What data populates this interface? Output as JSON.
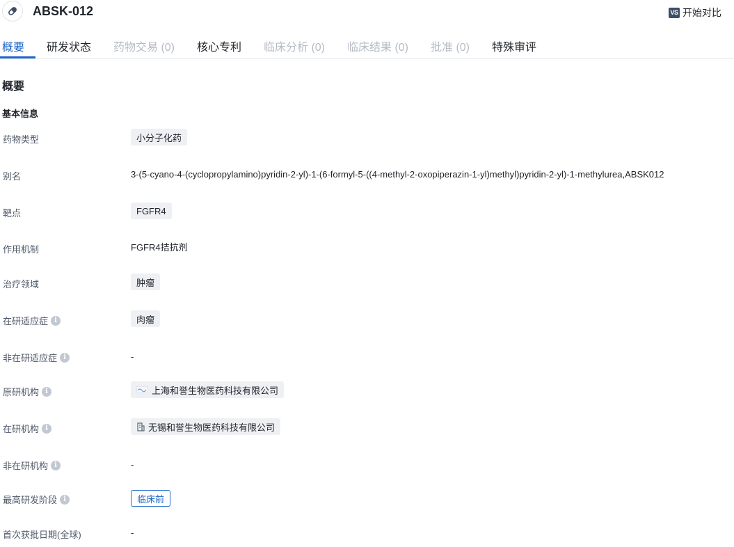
{
  "header": {
    "title": "ABSK-012",
    "compare_icon_text": "VS",
    "compare_label": "开始对比"
  },
  "tabs": [
    {
      "label": "概要",
      "state": "active"
    },
    {
      "label": "研发状态",
      "state": "enabled"
    },
    {
      "label": "药物交易 (0)",
      "state": "disabled"
    },
    {
      "label": "核心专利",
      "state": "enabled"
    },
    {
      "label": "临床分析 (0)",
      "state": "disabled"
    },
    {
      "label": "临床结果 (0)",
      "state": "disabled"
    },
    {
      "label": "批准 (0)",
      "state": "disabled"
    },
    {
      "label": "特殊审评",
      "state": "enabled"
    }
  ],
  "overview": {
    "title": "概要",
    "basic_info_title": "基本信息",
    "rows": {
      "drug_type": {
        "label": "药物类型",
        "value": "小分子化药"
      },
      "alias": {
        "label": "别名",
        "value": "3-(5-cyano-4-(cyclopropylamino)pyridin-2-yl)-1-(6-formyl-5-((4-methyl-2-oxopiperazin-1-yl)methyl)pyridin-2-yl)-1-methylurea,ABSK012"
      },
      "target": {
        "label": "靶点",
        "value": "FGFR4"
      },
      "mechanism": {
        "label": "作用机制",
        "value": "FGFR4拮抗剂"
      },
      "therapeutic_area": {
        "label": "治疗领域",
        "value": "肿瘤"
      },
      "active_indication": {
        "label": "在研适应症",
        "value": "肉瘤"
      },
      "inactive_indication": {
        "label": "非在研适应症",
        "value": "-"
      },
      "originator": {
        "label": "原研机构",
        "value": "上海和誉生物医药科技有限公司"
      },
      "active_org": {
        "label": "在研机构",
        "value": "无锡和誉生物医药科技有限公司"
      },
      "inactive_org": {
        "label": "非在研机构",
        "value": "-"
      },
      "highest_phase": {
        "label": "最高研发阶段",
        "value": "临床前"
      },
      "first_approval_date": {
        "label": "首次获批日期(全球)",
        "value": "-"
      }
    },
    "info_icon_glyph": "i"
  },
  "colors": {
    "accent": "#1b66c9",
    "tag_bg": "#eef0f3",
    "muted_tab": "#b6bcc6",
    "info_icon": "#c2c8d1"
  }
}
